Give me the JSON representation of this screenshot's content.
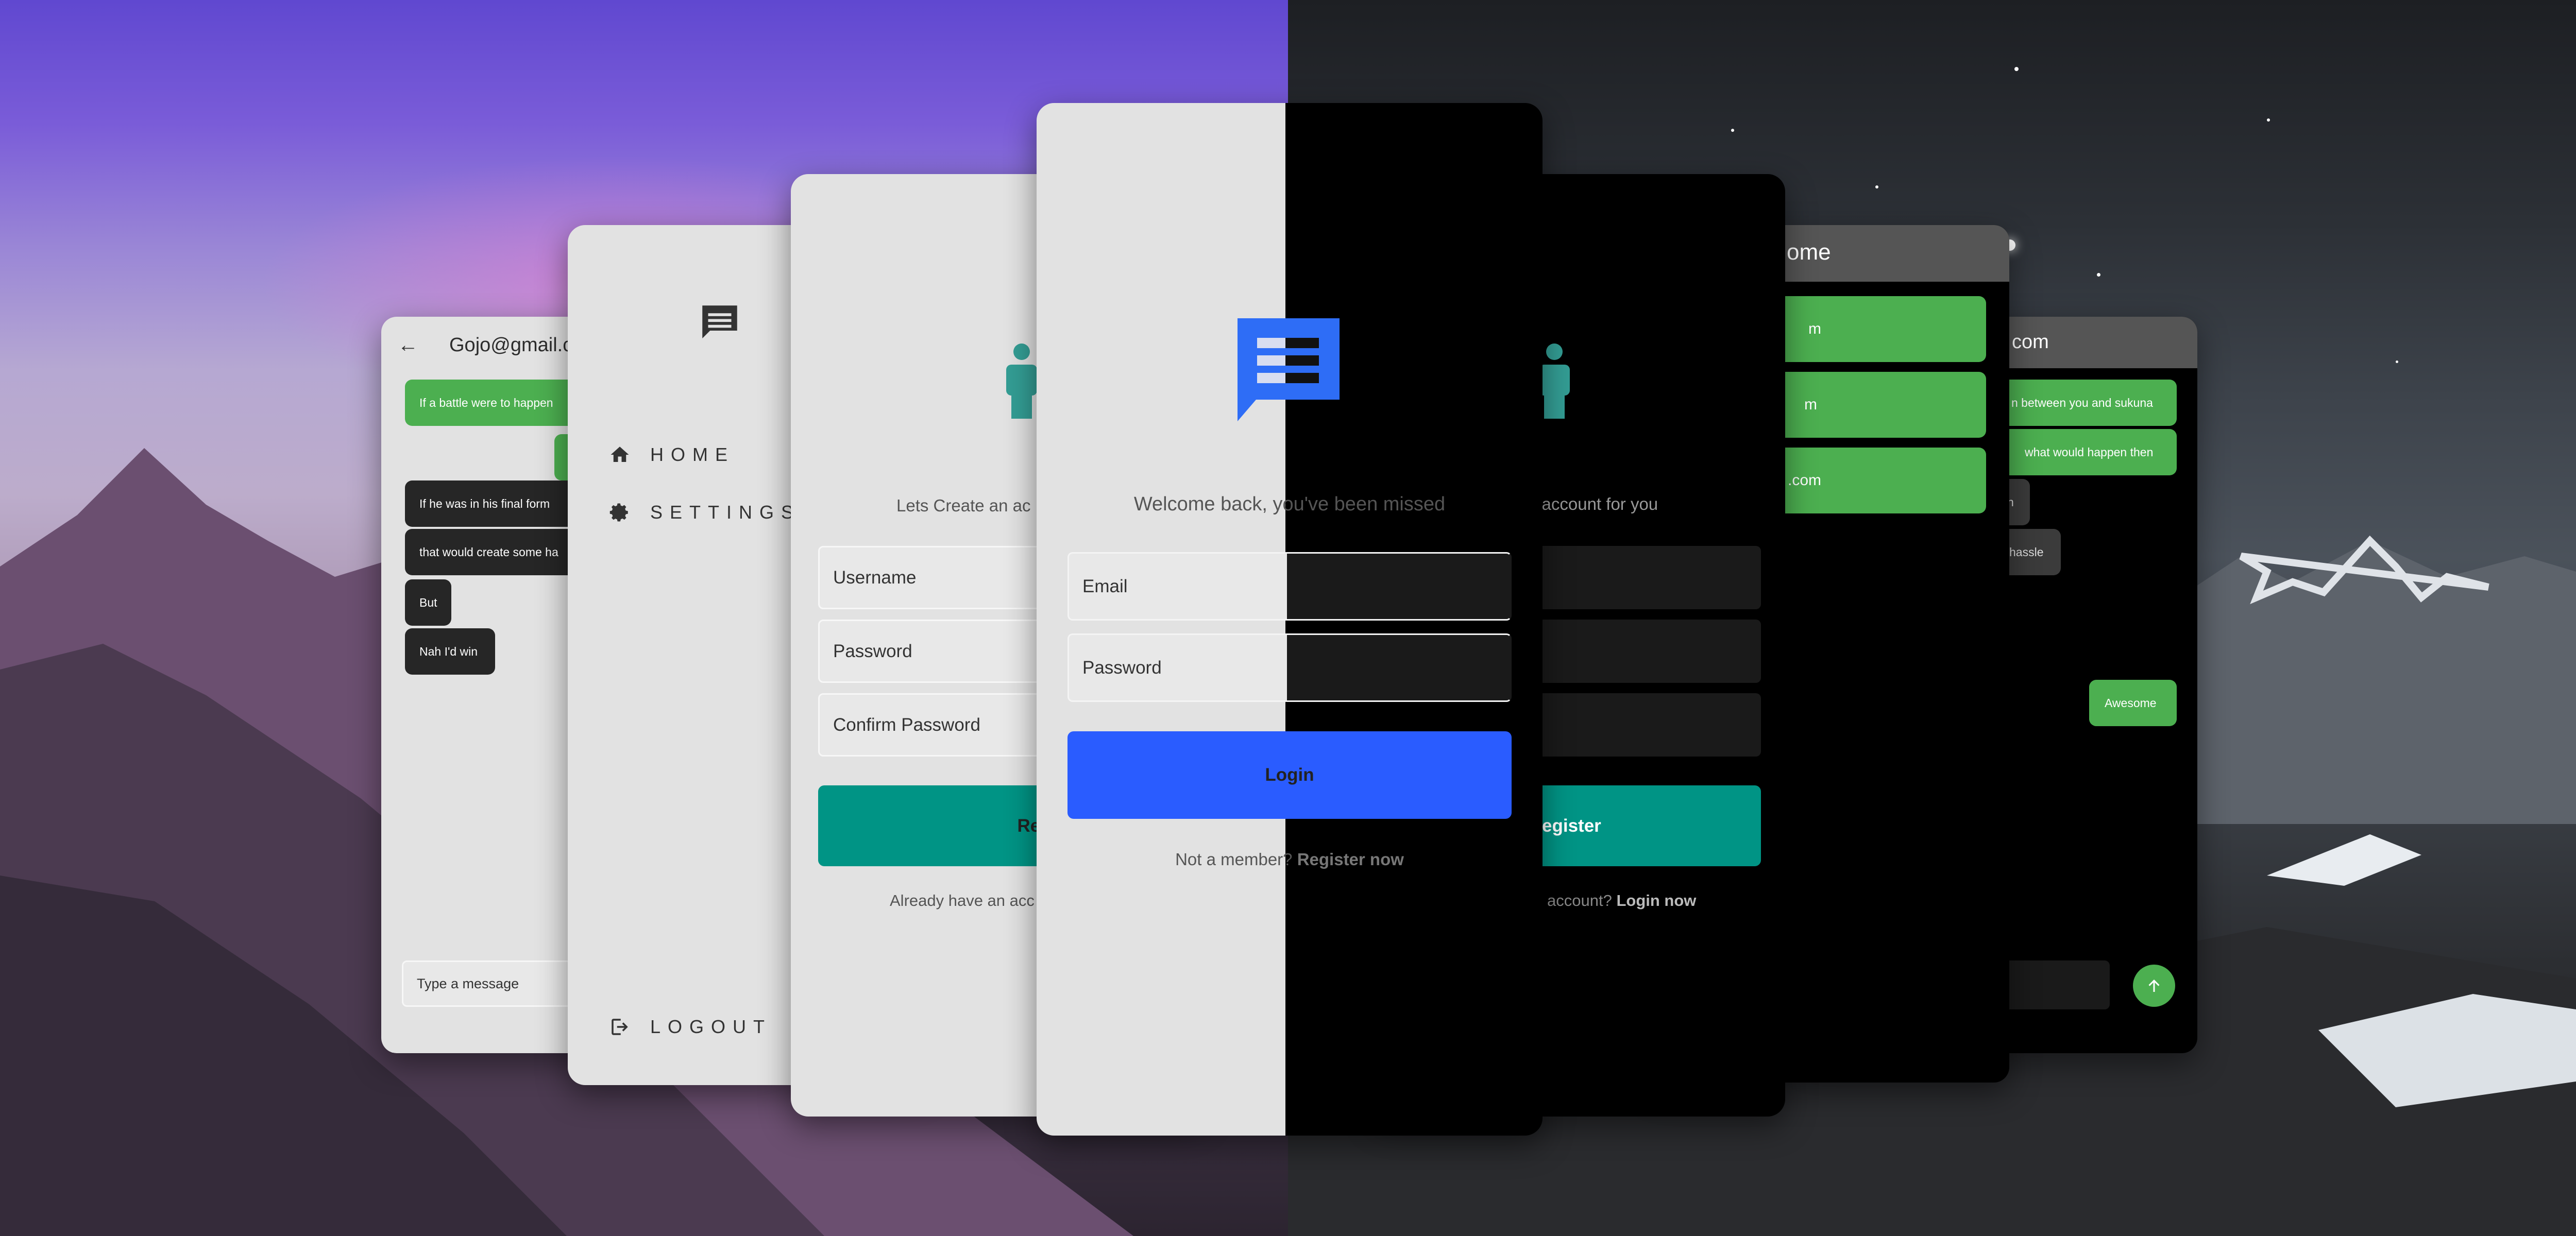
{
  "colors": {
    "primary_blue": "#2962ff",
    "teal": "#009485",
    "green": "#4caf50",
    "dark_bubble": "#262626"
  },
  "chat_light": {
    "title": "Gojo@gmail.co",
    "messages": [
      "If a battle were to happen",
      "If he was in his final form",
      "that would create some ha",
      "But",
      "Nah I'd win"
    ],
    "input_placeholder": "Type a message"
  },
  "drawer_light": {
    "items": [
      {
        "label": "HOME",
        "icon": "home-icon"
      },
      {
        "label": "SETTINGS",
        "icon": "gear-icon"
      }
    ],
    "logout": "LOGOUT"
  },
  "register_light": {
    "welcome": "Lets Create an ac",
    "fields": [
      "Username",
      "Password",
      "Confirm Password"
    ],
    "button": "Regist",
    "footer": "Already have an acc"
  },
  "login_center": {
    "welcome": "Welcome back, you've been missed",
    "email": "Email",
    "password": "Password",
    "button": "Login",
    "footer_prefix": "Not a member?",
    "footer_link": "Register now"
  },
  "register_dark": {
    "welcome": "n account for you",
    "button": "egister",
    "footer_prefix": "account?",
    "footer_link": "Login now"
  },
  "home_dark": {
    "title": "ome",
    "users": [
      "m",
      "m",
      ".com"
    ]
  },
  "chat_dark": {
    "title": "com",
    "messages": [
      "n between you and sukuna",
      "what would happen then",
      "n",
      "hassle",
      "Awesome"
    ]
  }
}
